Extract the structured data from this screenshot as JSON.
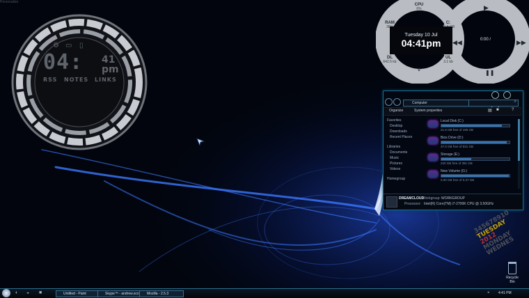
{
  "desktop": {
    "corner_label": "Personalize"
  },
  "clock_widget": {
    "hours": "04:",
    "minutes": "41",
    "ampm": "pm",
    "links": [
      "RSS",
      "NOTES",
      "LINKS"
    ],
    "icons": [
      "gear-icon",
      "monitor-icon",
      "document-icon"
    ]
  },
  "system_rings": {
    "cpu": {
      "label": "CPU",
      "value": "6%"
    },
    "ram": {
      "label": "RAM",
      "value": "36%"
    },
    "c_drive": {
      "label": "C:",
      "value": "21.6 GB"
    },
    "dl": {
      "label": "DL",
      "value": "642.5 kb"
    },
    "ul": {
      "label": "UL",
      "value": "3.1 kb"
    },
    "bottom": {
      "label": "0"
    },
    "date": "Tuesday   10   Jul",
    "time": "04:41pm"
  },
  "media_ring": {
    "position": "0:00 /"
  },
  "explorer": {
    "address": "Computer",
    "organize_label": "Organize",
    "system_properties_label": "System properties",
    "nav_items": [
      "Favorites",
      "Desktop",
      "Downloads",
      "Recent Places",
      "Libraries",
      "Documents",
      "Music",
      "Pictures",
      "Videos",
      "Homegroup"
    ],
    "drives": [
      {
        "name": "Local Disk (C:)",
        "free": "21.6 GB free of 195 GB",
        "used_fraction": 0.89
      },
      {
        "name": "Bios Drive (D:)",
        "free": "37.0 GB free of 931 GB",
        "used_fraction": 0.96
      },
      {
        "name": "Storage (E:)",
        "free": "220 GB free of 391 GB",
        "used_fraction": 0.44
      },
      {
        "name": "New Volume (G:)",
        "free": "0.00 GB free of 0.37 GB",
        "used_fraction": 0.99
      }
    ],
    "computer_name": "DREAMCLOUD",
    "workgroup_label": "Workgroup:",
    "workgroup": "WORKGROUP",
    "processor_label": "Processor:",
    "processor": "Intel(R) Core(TM) i7-2700K CPU @ 3.50GHz"
  },
  "date_art": {
    "lines": [
      "345678910",
      "TUESDAY",
      "2012",
      "MONDAY",
      "WEDNES"
    ]
  },
  "taskbar": {
    "buttons": [
      {
        "label": "Untitled - Paint"
      },
      {
        "label": "Skype™ - andrew.sco..."
      },
      {
        "label": "Mozilla - 2.5.3"
      }
    ],
    "tray_time": "4:41 PM"
  },
  "recycle_bin": {
    "label": "Recycle Bin"
  },
  "colors": {
    "accent": "#1a6e8c",
    "ring": "#bfc3c8",
    "glow": "#2f6dff"
  }
}
